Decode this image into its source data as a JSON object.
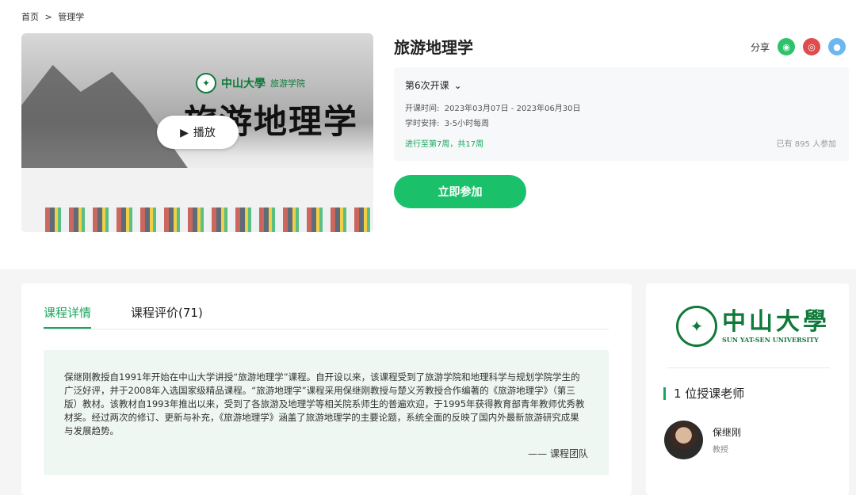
{
  "breadcrumb": {
    "home": "首页",
    "sep": ">",
    "current": "管理学"
  },
  "cover": {
    "logo_cn": "中山大學",
    "logo_sub": "旅游学院",
    "title": "旅游地理学",
    "play_label": "播放"
  },
  "course": {
    "title": "旅游地理学",
    "share_label": "分享",
    "share_icons": [
      "wechat-icon",
      "weibo-icon",
      "qq-icon"
    ],
    "session": "第6次开课",
    "time_label": "开课时间:",
    "time_value": "2023年03月07日 - 2023年06月30日",
    "schedule_label": "学时安排:",
    "schedule_value": "3-5小时每周",
    "progress": "进行至第7周，共17周",
    "participants": "已有 895 人参加",
    "join_label": "立即参加"
  },
  "tabs": [
    {
      "label": "课程详情",
      "active": true
    },
    {
      "label": "课程评价(71)",
      "active": false
    }
  ],
  "description": {
    "text": "保继刚教授自1991年开始在中山大学讲授“旅游地理学”课程。自开设以来，该课程受到了旅游学院和地理科学与规划学院学生的广泛好评，并于2008年入选国家级精品课程。“旅游地理学”课程采用保继刚教授与楚义芳教授合作编著的《旅游地理学》（第三版）教材。该教材自1993年推出以来，受到了各旅游及地理学等相关院系师生的普遍欢迎，于1995年获得教育部青年教师优秀教材奖。经过两次的修订、更新与补充，《旅游地理学》涵盖了旅游地理学的主要论题，系统全面的反映了国内外最新旅游研究成果与发展趋势。",
    "signature": "—— 课程团队"
  },
  "side": {
    "uni_cn": "中山大學",
    "uni_en": "SUN YAT-SEN UNIVERSITY",
    "teacher_heading": "1 位授课老师",
    "teacher_name": "保继刚",
    "teacher_title": "教授"
  },
  "colors": {
    "accent": "#1aa55c",
    "button": "#1bc16a",
    "brand": "#0f7a3a"
  }
}
